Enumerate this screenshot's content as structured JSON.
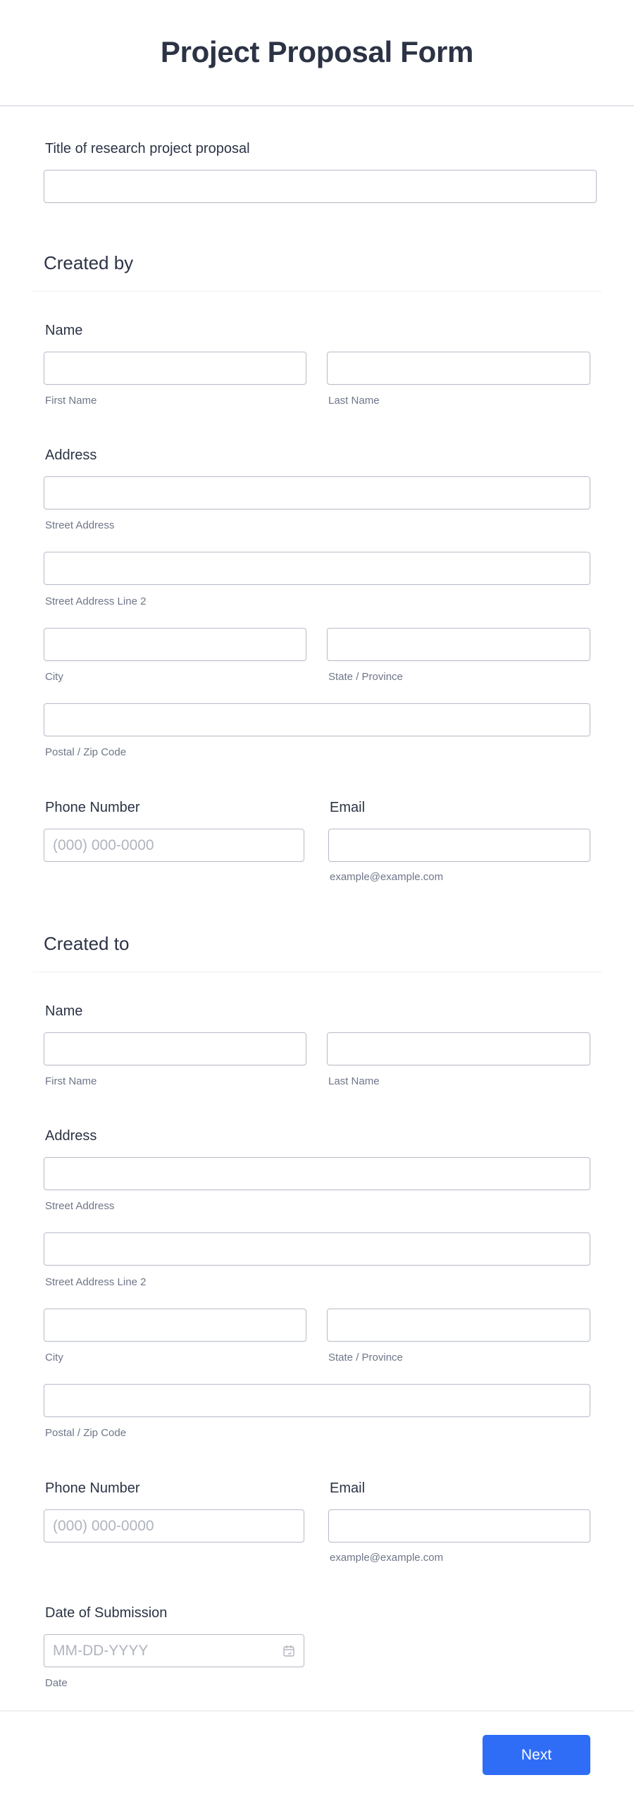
{
  "header": {
    "title": "Project Proposal Form"
  },
  "project_title": {
    "label": "Title of research project proposal",
    "value": ""
  },
  "created_by": {
    "section_title": "Created by",
    "name": {
      "label": "Name",
      "first_sublabel": "First Name",
      "last_sublabel": "Last Name"
    },
    "address": {
      "label": "Address",
      "street_sublabel": "Street Address",
      "street2_sublabel": "Street Address Line 2",
      "city_sublabel": "City",
      "state_sublabel": "State / Province",
      "postal_sublabel": "Postal / Zip Code"
    },
    "phone": {
      "label": "Phone Number",
      "placeholder": "(000) 000-0000"
    },
    "email": {
      "label": "Email",
      "sublabel": "example@example.com"
    }
  },
  "created_to": {
    "section_title": "Created to",
    "name": {
      "label": "Name",
      "first_sublabel": "First Name",
      "last_sublabel": "Last Name"
    },
    "address": {
      "label": "Address",
      "street_sublabel": "Street Address",
      "street2_sublabel": "Street Address Line 2",
      "city_sublabel": "City",
      "state_sublabel": "State / Province",
      "postal_sublabel": "Postal / Zip Code"
    },
    "phone": {
      "label": "Phone Number",
      "placeholder": "(000) 000-0000"
    },
    "email": {
      "label": "Email",
      "sublabel": "example@example.com"
    }
  },
  "date_of_submission": {
    "label": "Date of Submission",
    "placeholder": "MM-DD-YYYY",
    "sublabel": "Date",
    "icon": "calendar-icon"
  },
  "footer": {
    "next_label": "Next",
    "accent_color": "#2f6df6"
  }
}
